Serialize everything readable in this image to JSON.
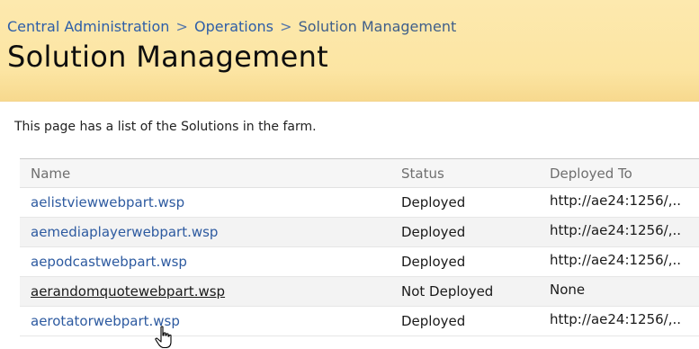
{
  "breadcrumb": {
    "items": [
      "Central Administration",
      "Operations",
      "Solution Management"
    ],
    "separator": ">"
  },
  "page": {
    "title": "Solution Management",
    "description": "This page has a list of the Solutions in the farm."
  },
  "table": {
    "headers": [
      "Name",
      "Status",
      "Deployed To"
    ],
    "rows": [
      {
        "name": "aelistviewwebpart.wsp",
        "status": "Deployed",
        "deployed_to": "http://ae24:1256/,.."
      },
      {
        "name": "aemediaplayerwebpart.wsp",
        "status": "Deployed",
        "deployed_to": "http://ae24:1256/,.."
      },
      {
        "name": "aepodcastwebpart.wsp",
        "status": "Deployed",
        "deployed_to": "http://ae24:1256/,.."
      },
      {
        "name": "aerandomquotewebpart.wsp",
        "status": "Not Deployed",
        "deployed_to": "None"
      },
      {
        "name": "aerotatorwebpart.wsp",
        "status": "Deployed",
        "deployed_to": "http://ae24:1256/,.."
      }
    ]
  },
  "colors": {
    "banner": "#fce5a3",
    "link": "#2d5aa0",
    "breadcrumb": "#3366aa"
  },
  "cursor": {
    "icon": "hand-pointer-icon"
  }
}
